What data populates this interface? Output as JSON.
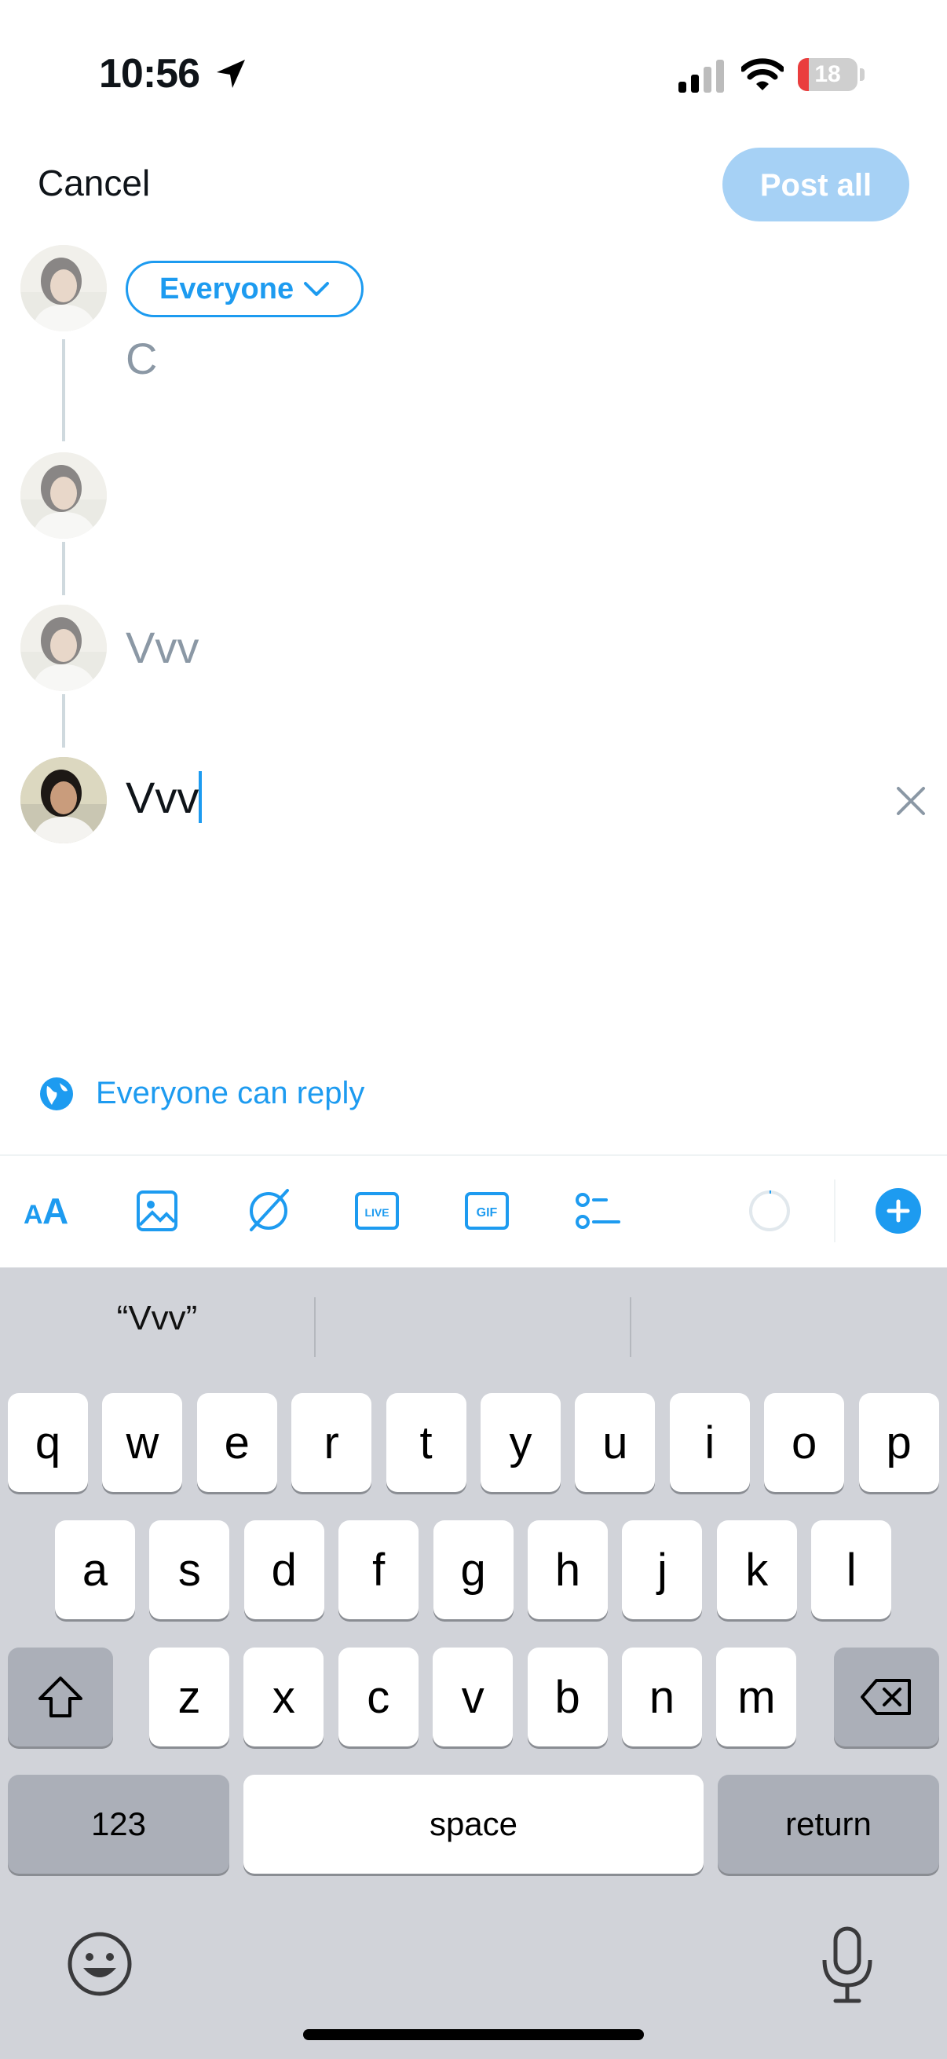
{
  "status_bar": {
    "time": "10:56",
    "battery_level": "18",
    "battery_fill": 0.18
  },
  "header": {
    "cancel_label": "Cancel",
    "post_all_label": "Post all"
  },
  "thread": {
    "audience_label": "Everyone",
    "posts": [
      {
        "text": "C"
      },
      {
        "text": ""
      },
      {
        "text": "Vvv"
      },
      {
        "text": "Vvv"
      }
    ]
  },
  "reply_setting": {
    "label": "Everyone can reply"
  },
  "toolbar": {
    "icons": [
      "text-format-icon",
      "image-icon",
      "no-location-icon",
      "live-icon",
      "gif-icon",
      "poll-icon",
      "character-count-icon",
      "add-post-icon"
    ],
    "live_label": "LIVE",
    "gif_label": "GIF",
    "format_label": "AA"
  },
  "keyboard": {
    "suggestion": "“Vvv”",
    "row1": [
      "q",
      "w",
      "e",
      "r",
      "t",
      "y",
      "u",
      "i",
      "o",
      "p"
    ],
    "row2": [
      "a",
      "s",
      "d",
      "f",
      "g",
      "h",
      "j",
      "k",
      "l"
    ],
    "row3": [
      "z",
      "x",
      "c",
      "v",
      "b",
      "n",
      "m"
    ],
    "numbers_label": "123",
    "space_label": "space",
    "return_label": "return"
  },
  "colors": {
    "accent": "#1d9bf0",
    "post_all_disabled": "#a6d1f5",
    "keyboard_bg": "#d1d3d9"
  }
}
